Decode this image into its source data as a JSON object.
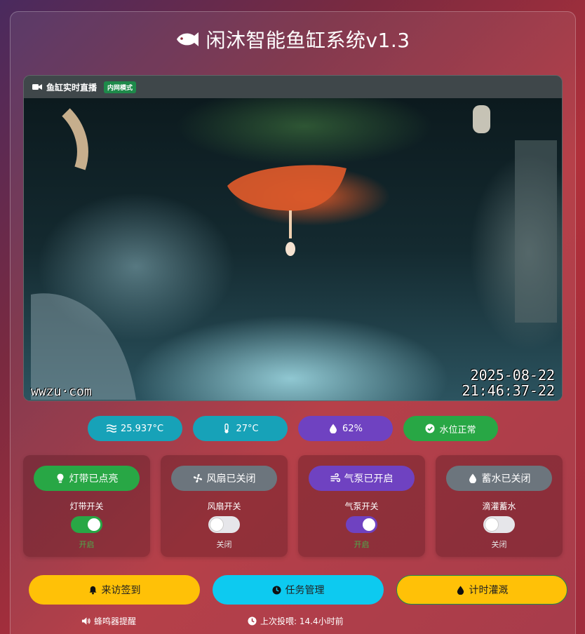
{
  "app": {
    "title": "闲沐智能鱼缸系统v1.3"
  },
  "video": {
    "header_label": "鱼缸实时直播",
    "mode_badge": "内网模式",
    "osd_date": "2025-08-22",
    "osd_time": "21:46:37-22",
    "osd_brand": "wwzu·com"
  },
  "status": [
    {
      "icon": "water-waves-icon",
      "text": "25.937°C",
      "color": "#17a2b8"
    },
    {
      "icon": "thermometer-icon",
      "text": "27°C",
      "color": "#17a2b8"
    },
    {
      "icon": "droplet-icon",
      "text": "62%",
      "color": "#6f42c1"
    },
    {
      "icon": "check-circle-icon",
      "text": "水位正常",
      "color": "#28a745"
    }
  ],
  "devices": [
    {
      "icon": "lightbulb-icon",
      "status_label": "灯带已点亮",
      "status_color": "#28a745",
      "switch_label": "灯带开关",
      "state_text": "开启",
      "on": true,
      "toggle_color": "#28a745",
      "state_color": "#4cae4c"
    },
    {
      "icon": "fan-icon",
      "status_label": "风扇已关闭",
      "status_color": "#6c757d",
      "switch_label": "风扇开关",
      "state_text": "关闭",
      "on": false,
      "toggle_color": "#e6e6ea",
      "state_color": "#e8e8e8"
    },
    {
      "icon": "wind-icon",
      "status_label": "气泵已开启",
      "status_color": "#6f42c1",
      "switch_label": "气泵开关",
      "state_text": "开启",
      "on": true,
      "toggle_color": "#6f42c1",
      "state_color": "#4cae4c"
    },
    {
      "icon": "water-drop-icon",
      "status_label": "蓄水已关闭",
      "status_color": "#6c757d",
      "switch_label": "滴灌蓄水",
      "state_text": "关闭",
      "on": false,
      "toggle_color": "#e6e6ea",
      "state_color": "#e8e8e8"
    }
  ],
  "actions": [
    {
      "icon": "bell-icon",
      "label": "来访签到",
      "color": "#ffc107"
    },
    {
      "icon": "clock-icon",
      "label": "任务管理",
      "color": "#0dcaf0"
    },
    {
      "icon": "drop-icon",
      "label": "计时灌溉",
      "color": "#ffc107"
    }
  ],
  "footer": {
    "buzzer_label": "蜂鸣器提醒",
    "last_feed": "上次投喂: 14.4小时前"
  }
}
